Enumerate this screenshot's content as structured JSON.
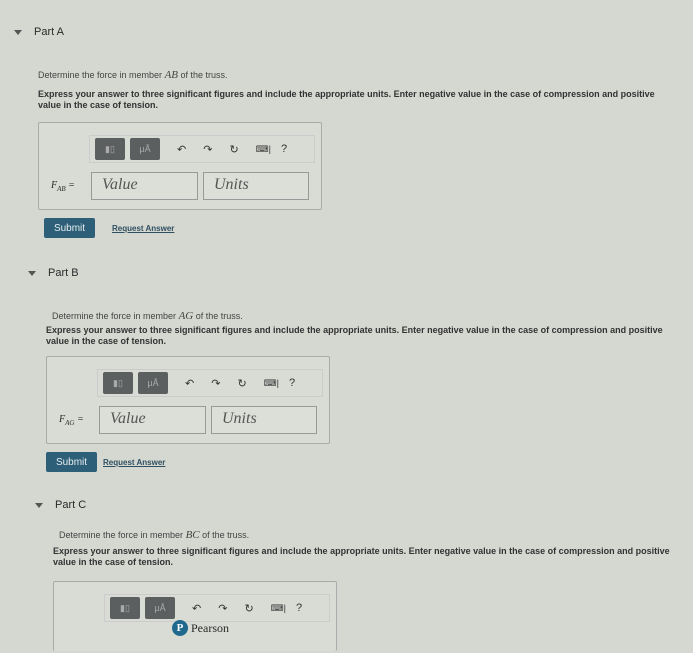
{
  "parts": [
    {
      "title": "Part A",
      "desc_pre": "Determine the force in member ",
      "member": "AB",
      "desc_post": " of the truss.",
      "instructions": "Express your answer to three significant figures and include the appropriate units. Enter negative value in the case of compression and positive value in the case of tension.",
      "var": "F",
      "sub": "AB",
      "value_placeholder": "Value",
      "units_placeholder": "Units",
      "submit": "Submit",
      "request": "Request Answer"
    },
    {
      "title": "Part B",
      "desc_pre": "Determine the force in member ",
      "member": "AG",
      "desc_post": " of the truss.",
      "instructions": "Express your answer to three significant figures and include the appropriate units. Enter negative value in the case of compression and positive value in the case of tension.",
      "var": "F",
      "sub": "AG",
      "value_placeholder": "Value",
      "units_placeholder": "Units",
      "submit": "Submit",
      "request": "Request Answer"
    },
    {
      "title": "Part C",
      "desc_pre": "Determine the force in member ",
      "member": "BC",
      "desc_post": " of the truss.",
      "instructions": "Express your answer to three significant figures and include the appropriate units. Enter negative value in the case of compression and positive value in the case of tension."
    }
  ],
  "toolbar": {
    "units_btn": "μÅ",
    "help": "?",
    "icons": [
      "template-icon",
      "units-icon",
      "undo-icon",
      "redo-icon",
      "reset-icon",
      "keyboard-icon",
      "help-icon"
    ]
  },
  "footer": {
    "logo_letter": "P",
    "brand": "Pearson"
  },
  "colors": {
    "submit": "#2d5f78",
    "background": "#d5d7d1"
  }
}
